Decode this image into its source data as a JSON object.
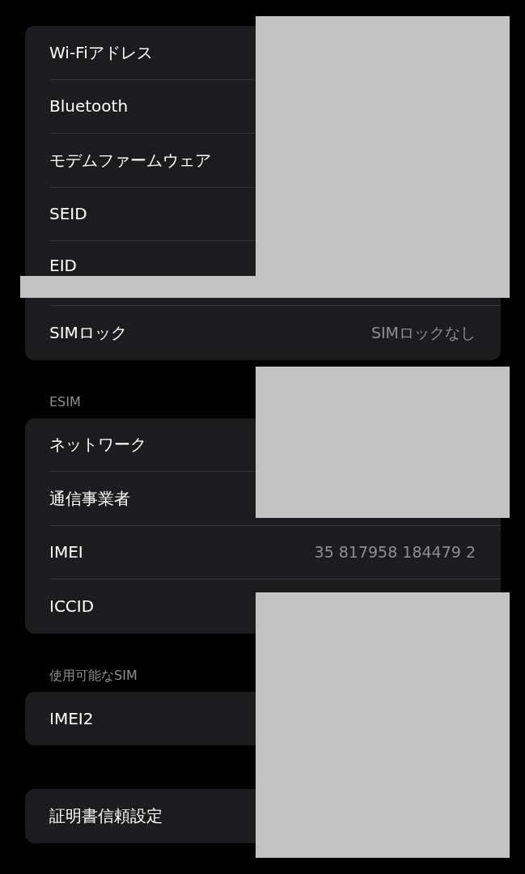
{
  "groups": [
    {
      "rows": [
        {
          "label": "Wi-Fiアドレス"
        },
        {
          "label": "Bluetooth"
        },
        {
          "label": "モデムファームウェア"
        },
        {
          "label": "SEID"
        },
        {
          "label": "EID",
          "kind": "tall"
        },
        {
          "label": "SIMロック",
          "value": "SIMロックなし"
        }
      ]
    },
    {
      "header": "ESIM",
      "rows": [
        {
          "label": "ネットワーク"
        },
        {
          "label": "通信事業者"
        },
        {
          "label": "IMEI",
          "value": "35 817958 184479 2"
        },
        {
          "label": "ICCID"
        }
      ]
    },
    {
      "header": "使用可能なSIM",
      "rows": [
        {
          "label": "IMEI2"
        }
      ]
    },
    {
      "rows": [
        {
          "label": "証明書信頼設定"
        }
      ]
    }
  ]
}
